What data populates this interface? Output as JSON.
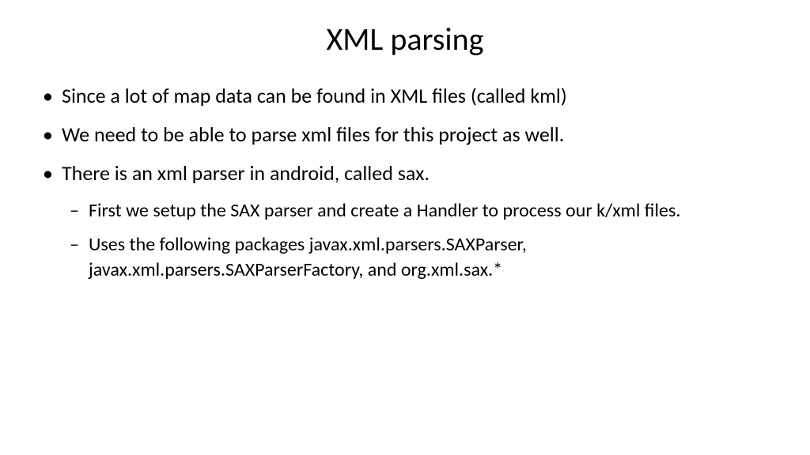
{
  "title": "XML parsing",
  "bullets": {
    "item1": "Since a lot of map data can be found in XML files (called kml)",
    "item2": "We need to be able to parse xml files for this project as well.",
    "item3": "There is an xml parser in android, called sax.",
    "sub1": "First we setup the SAX parser and create a Handler to process our k/xml files.",
    "sub2": "Uses the following packages javax.xml.parsers.SAXParser, javax.xml.parsers.SAXParserFactory, and org.xml.sax.*"
  }
}
